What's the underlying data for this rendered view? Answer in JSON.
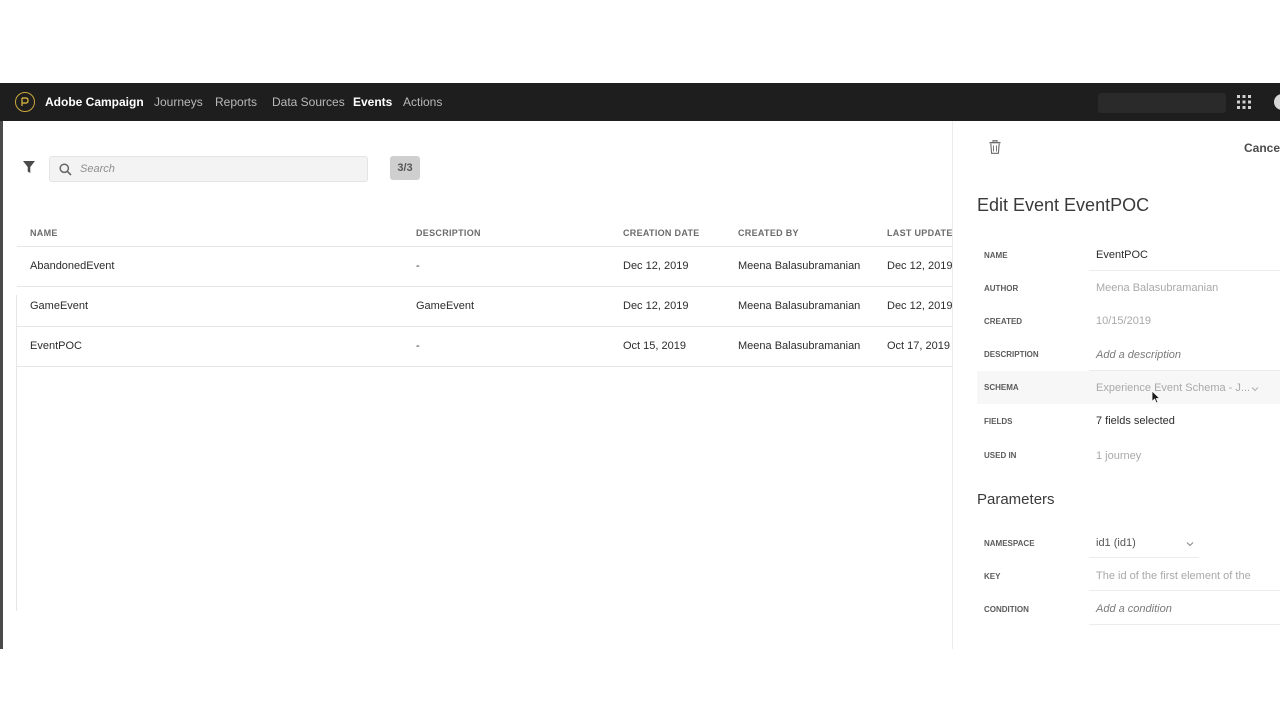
{
  "topbar": {
    "brand": "Adobe Campaign",
    "nav": [
      {
        "label": "Journeys",
        "active": false
      },
      {
        "label": "Reports",
        "active": false
      },
      {
        "label": "Data Sources",
        "active": false
      },
      {
        "label": "Events",
        "active": true
      },
      {
        "label": "Actions",
        "active": false
      }
    ]
  },
  "toolbar": {
    "search_placeholder": "Search",
    "count": "3/3"
  },
  "table": {
    "columns": [
      "NAME",
      "DESCRIPTION",
      "CREATION DATE",
      "CREATED BY",
      "LAST UPDATE"
    ],
    "rows": [
      {
        "name": "AbandonedEvent",
        "description": "-",
        "creation_date": "Dec 12, 2019",
        "created_by": "Meena Balasubramanian",
        "last_update": "Dec 12, 2019"
      },
      {
        "name": "GameEvent",
        "description": "GameEvent",
        "creation_date": "Dec 12, 2019",
        "created_by": "Meena Balasubramanian",
        "last_update": "Dec 12, 2019"
      },
      {
        "name": "EventPOC",
        "description": "-",
        "creation_date": "Oct 15, 2019",
        "created_by": "Meena Balasubramanian",
        "last_update": "Oct 17, 2019"
      }
    ]
  },
  "panel": {
    "cancel_label": "Cancel",
    "title": "Edit Event EventPOC",
    "fields": {
      "name": {
        "label": "NAME",
        "value": "EventPOC"
      },
      "author": {
        "label": "AUTHOR",
        "value": "Meena Balasubramanian"
      },
      "created": {
        "label": "CREATED",
        "value": "10/15/2019"
      },
      "description": {
        "label": "DESCRIPTION",
        "placeholder": "Add a description"
      },
      "schema": {
        "label": "SCHEMA",
        "value": "Experience Event Schema - J..."
      },
      "fields": {
        "label": "FIELDS",
        "value": "7 fields selected"
      },
      "used_in": {
        "label": "USED IN",
        "value": "1 journey"
      }
    },
    "parameters_title": "Parameters",
    "parameters": {
      "namespace": {
        "label": "NAMESPACE",
        "value": "id1 (id1)"
      },
      "key": {
        "label": "KEY",
        "value": "The id of the first element of the"
      },
      "condition": {
        "label": "CONDITION",
        "placeholder": "Add a condition"
      }
    }
  },
  "colors": {
    "topbar_bg": "#1e1e1e",
    "logo_accent": "#c8a73c"
  }
}
